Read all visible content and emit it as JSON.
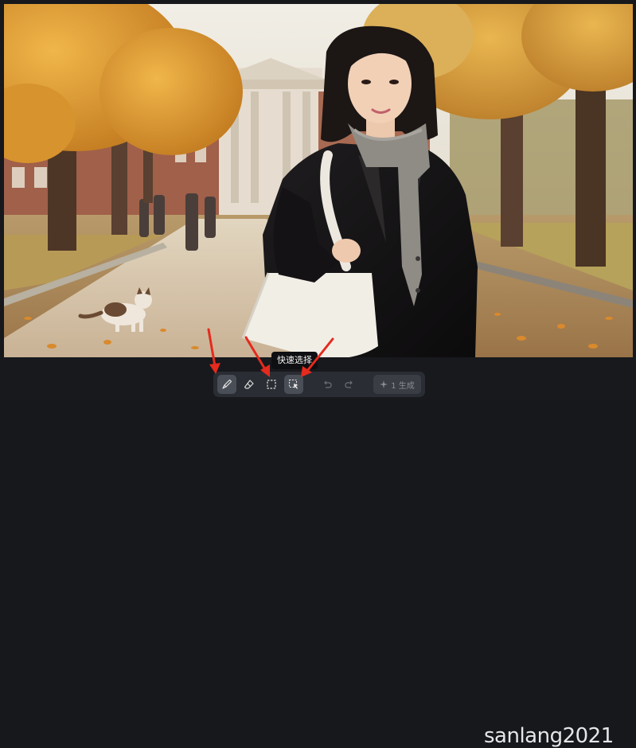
{
  "canvas": {
    "image": "portrait-photo"
  },
  "toolbar": {
    "tools": [
      {
        "name": "brush",
        "icon": "brush-icon",
        "active": true
      },
      {
        "name": "eraser",
        "icon": "eraser-icon",
        "active": false
      },
      {
        "name": "rect-select",
        "icon": "rect-select-icon",
        "active": false
      },
      {
        "name": "quick-select",
        "icon": "quick-select-icon",
        "active": true
      }
    ],
    "undo_icon": "undo-icon",
    "redo_icon": "redo-icon",
    "generate": {
      "icon": "sparkle-icon",
      "label": "1 生成"
    }
  },
  "tooltip": {
    "text": "快速选择"
  },
  "watermark": {
    "text": "sanlang2021"
  },
  "colors": {
    "annotation_arrow": "#e52a1e",
    "bar_bg": "#17191d",
    "toolbar_bg": "#2a2d33"
  }
}
